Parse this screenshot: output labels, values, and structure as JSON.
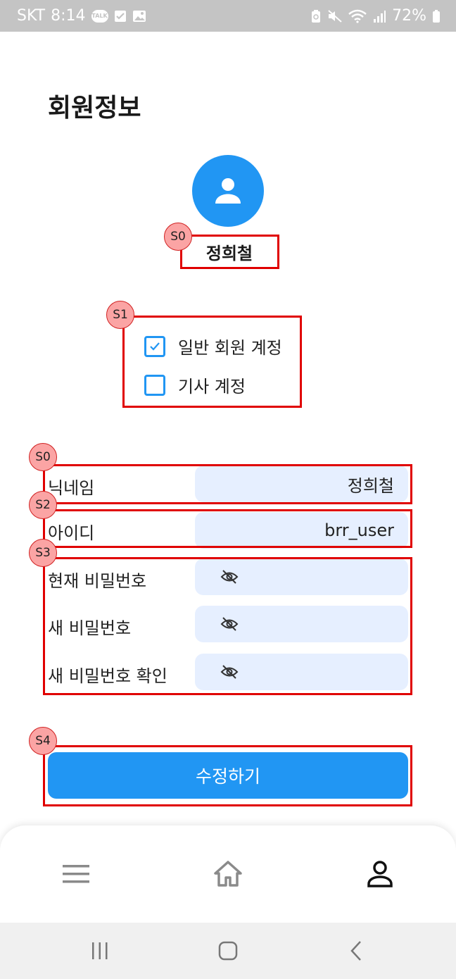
{
  "status_bar": {
    "carrier": "SKT",
    "time": "8:14",
    "battery": "72%",
    "talk_icon_label": "TALK"
  },
  "page": {
    "title": "회원정보"
  },
  "profile": {
    "name": "정희철"
  },
  "account_types": [
    {
      "label": "일반 회원 계정",
      "checked": true
    },
    {
      "label": "기사 계정",
      "checked": false
    }
  ],
  "form": {
    "nickname_label": "닉네임",
    "nickname_value": "정희철",
    "id_label": "아이디",
    "id_value": "brr_user",
    "current_pw_label": "현재 비밀번호",
    "new_pw_label": "새 비밀번호",
    "confirm_pw_label": "새 비밀번호 확인"
  },
  "submit_label": "수정하기",
  "annotations": {
    "s0_profile": "S0",
    "s1_account": "S1",
    "s0_nickname": "S0",
    "s2_id": "S2",
    "s3_password": "S3",
    "s4_submit": "S4"
  },
  "colors": {
    "accent": "#2196f3",
    "field_bg": "#e6efff",
    "annotation": "#e00000"
  },
  "bottom_nav": [
    {
      "icon": "menu-icon"
    },
    {
      "icon": "home-icon"
    },
    {
      "icon": "person-icon"
    }
  ]
}
